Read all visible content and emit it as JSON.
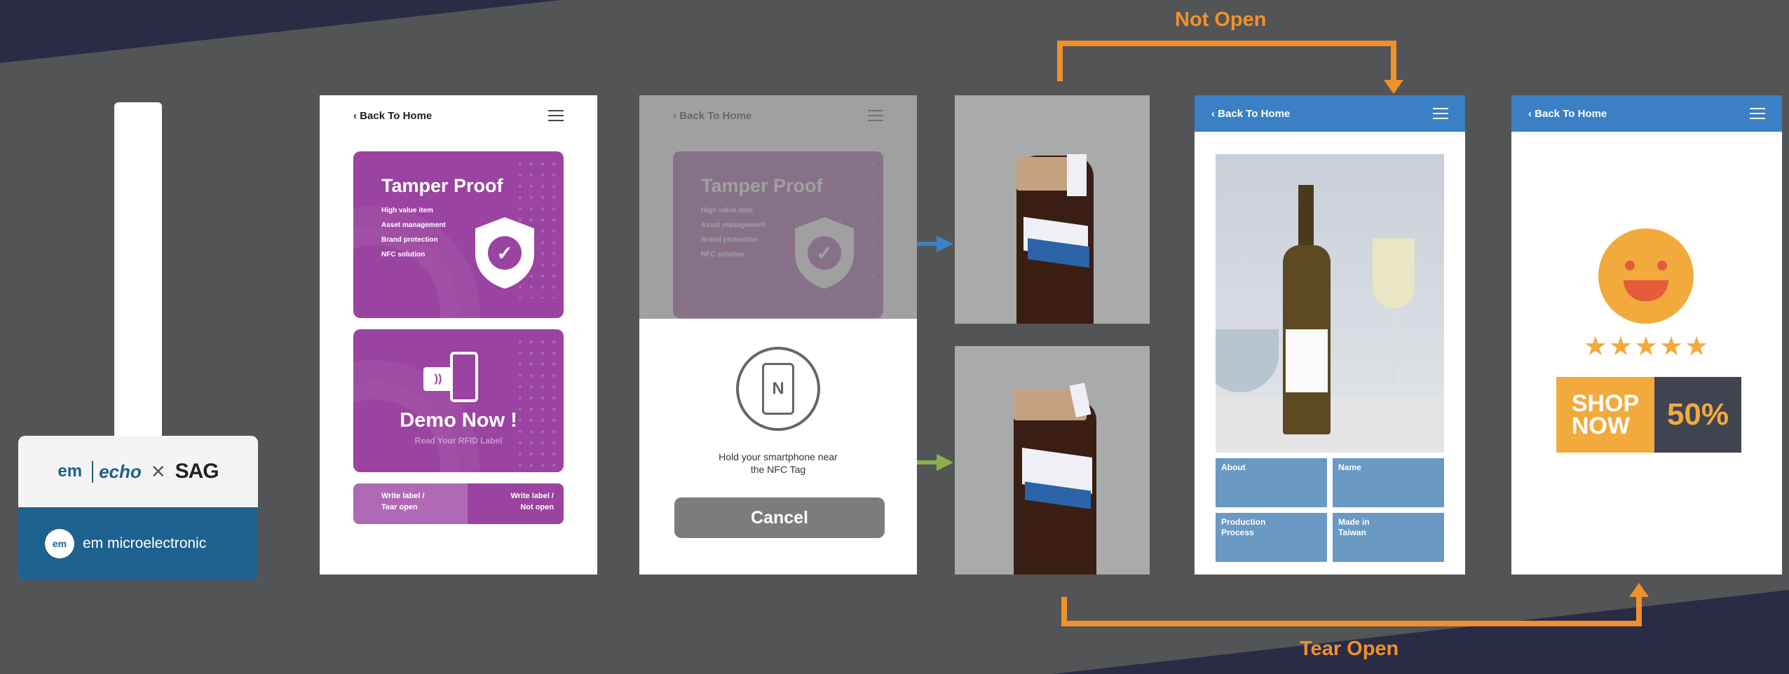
{
  "flow": {
    "not_open_label": "Not Open",
    "tear_open_label": "Tear Open"
  },
  "tag": {
    "brand_em": "em",
    "brand_echo": "echo",
    "times": "×",
    "partner": "SAG",
    "logo": "em",
    "company": "em microelectronic"
  },
  "phone_home": {
    "back": "Back To Home",
    "tamper": {
      "title": "Tamper Proof",
      "bullets": [
        "High value item",
        "Asset management",
        "Brand protection",
        "NFC solution"
      ]
    },
    "demo": {
      "title": "Demo Now !",
      "subtitle": "Read Your RFID Label"
    },
    "write_tear": [
      "Write label /",
      "Tear open"
    ],
    "write_not": [
      "Write label /",
      "Not open"
    ]
  },
  "phone_scan": {
    "instruction_line1": "Hold your smartphone near",
    "instruction_line2": "the NFC Tag",
    "cancel": "Cancel",
    "nfc_glyph": "N"
  },
  "phone_info": {
    "back": "Back To Home",
    "fields": [
      "About",
      "Name",
      "Production\nProcess",
      "Made in\nTaiwan"
    ]
  },
  "phone_promo": {
    "back": "Back To Home",
    "stars": "★★★★★",
    "shop_line1": "SHOP",
    "shop_line2": "NOW",
    "discount": "50%"
  },
  "colors": {
    "purple": "#9a43a0",
    "orange_arrow": "#f0912c",
    "blue_arrow": "#3b82c4",
    "green_arrow": "#8ab04b",
    "nav_blue": "#3b7fc4"
  }
}
